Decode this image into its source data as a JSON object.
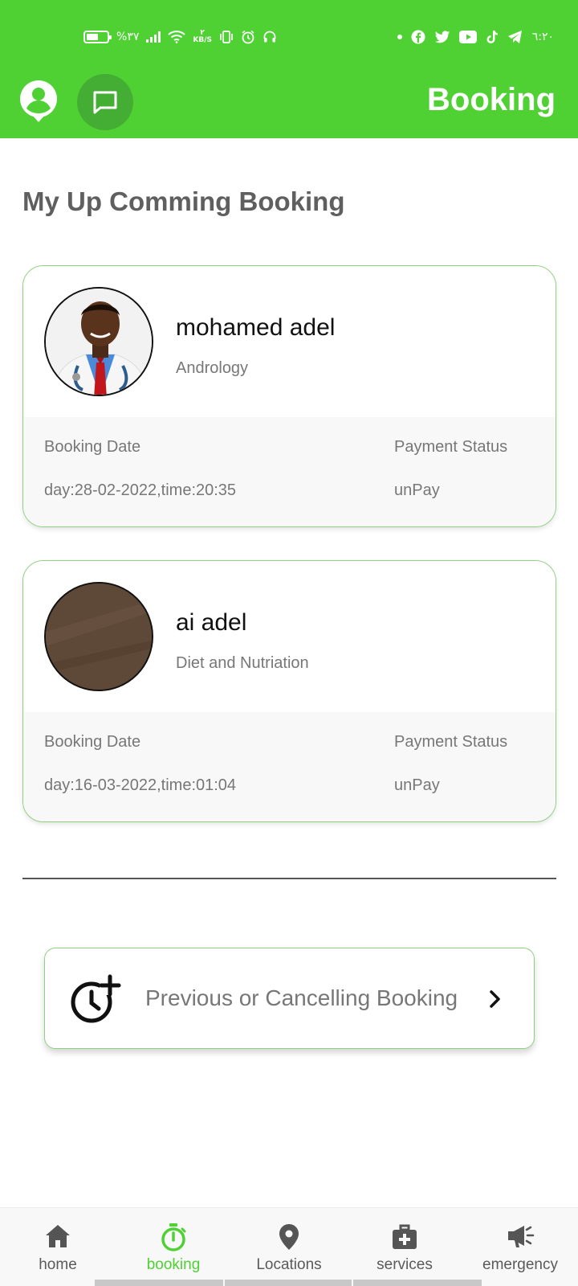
{
  "status_bar": {
    "battery_text": "%٣٧",
    "net_speed_top": "٢",
    "net_speed_unit": "KB/S",
    "time": "٦:٢٠"
  },
  "app_bar": {
    "title": "Booking"
  },
  "section_title": "My Up Comming Booking",
  "bookings": [
    {
      "doctor_name": "mohamed adel",
      "specialty": "Andrology",
      "date_label": "Booking Date",
      "date_value": "day:28-02-2022,time:20:35",
      "payment_label": "Payment Status",
      "payment_value": "unPay"
    },
    {
      "doctor_name": "ai adel",
      "specialty": "Diet and Nutriation",
      "date_label": "Booking Date",
      "date_value": "day:16-03-2022,time:01:04",
      "payment_label": "Payment Status",
      "payment_value": "unPay"
    }
  ],
  "previous_button": {
    "label": "Previous or Cancelling Booking"
  },
  "bottom_nav": {
    "items": [
      {
        "label": "home",
        "icon": "home-icon"
      },
      {
        "label": "booking",
        "icon": "stopwatch-icon",
        "active": true
      },
      {
        "label": "Locations",
        "icon": "location-pin-icon"
      },
      {
        "label": "services",
        "icon": "medical-bag-icon"
      },
      {
        "label": "emergency",
        "icon": "megaphone-icon"
      }
    ]
  },
  "colors": {
    "brand_green": "#4fd134",
    "chat_button_bg": "#44ad34",
    "card_border": "#8fd17f",
    "muted_text": "#777777"
  }
}
